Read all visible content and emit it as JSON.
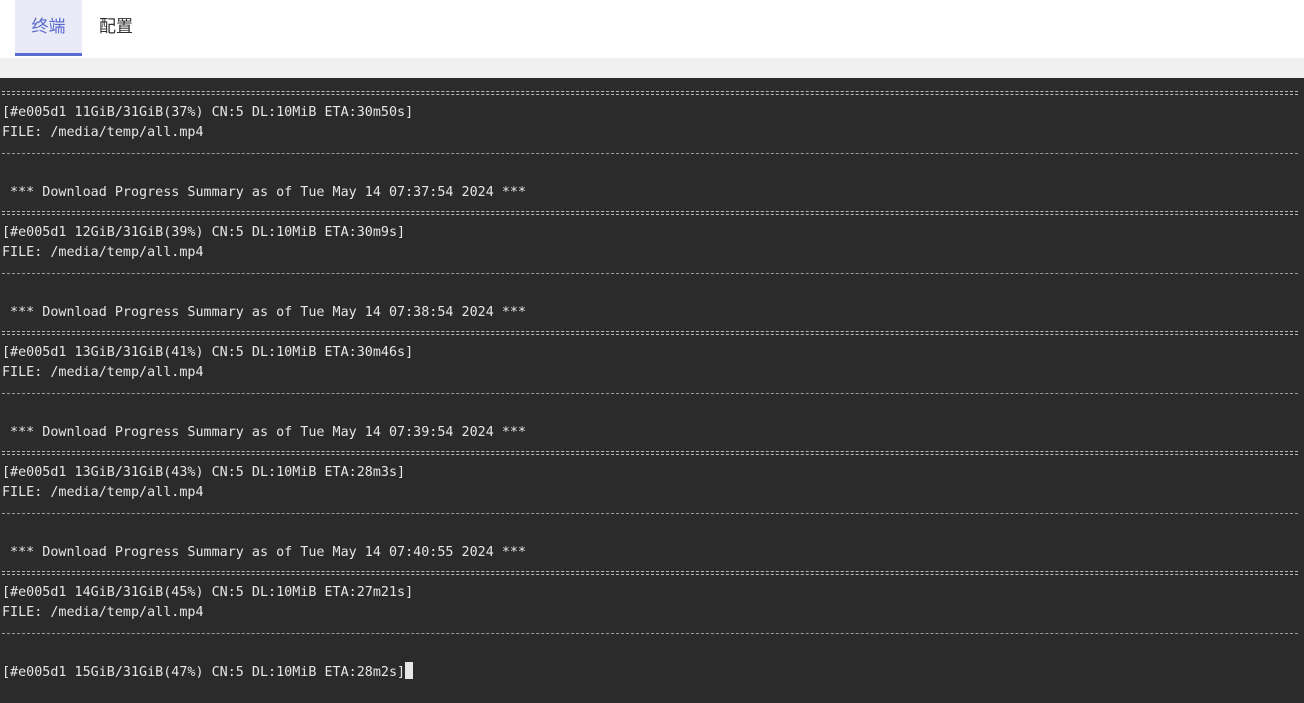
{
  "tabs": [
    {
      "label": "终端",
      "active": true
    },
    {
      "label": "配置",
      "active": false
    }
  ],
  "terminal": {
    "lines": [
      {
        "type": "sep-eq"
      },
      {
        "type": "text",
        "text": "[#e005d1 11GiB/31GiB(37%) CN:5 DL:10MiB ETA:30m50s]"
      },
      {
        "type": "text",
        "text": "FILE: /media/temp/all.mp4"
      },
      {
        "type": "sep-dash"
      },
      {
        "type": "blank"
      },
      {
        "type": "text",
        "text": " *** Download Progress Summary as of Tue May 14 07:37:54 2024 ***"
      },
      {
        "type": "sep-eq"
      },
      {
        "type": "text",
        "text": "[#e005d1 12GiB/31GiB(39%) CN:5 DL:10MiB ETA:30m9s]"
      },
      {
        "type": "text",
        "text": "FILE: /media/temp/all.mp4"
      },
      {
        "type": "sep-dash"
      },
      {
        "type": "blank"
      },
      {
        "type": "text",
        "text": " *** Download Progress Summary as of Tue May 14 07:38:54 2024 ***"
      },
      {
        "type": "sep-eq"
      },
      {
        "type": "text",
        "text": "[#e005d1 13GiB/31GiB(41%) CN:5 DL:10MiB ETA:30m46s]"
      },
      {
        "type": "text",
        "text": "FILE: /media/temp/all.mp4"
      },
      {
        "type": "sep-dash"
      },
      {
        "type": "blank"
      },
      {
        "type": "text",
        "text": " *** Download Progress Summary as of Tue May 14 07:39:54 2024 ***"
      },
      {
        "type": "sep-eq"
      },
      {
        "type": "text",
        "text": "[#e005d1 13GiB/31GiB(43%) CN:5 DL:10MiB ETA:28m3s]"
      },
      {
        "type": "text",
        "text": "FILE: /media/temp/all.mp4"
      },
      {
        "type": "sep-dash"
      },
      {
        "type": "blank"
      },
      {
        "type": "text",
        "text": " *** Download Progress Summary as of Tue May 14 07:40:55 2024 ***"
      },
      {
        "type": "sep-eq"
      },
      {
        "type": "text",
        "text": "[#e005d1 14GiB/31GiB(45%) CN:5 DL:10MiB ETA:27m21s]"
      },
      {
        "type": "text",
        "text": "FILE: /media/temp/all.mp4"
      },
      {
        "type": "sep-dash"
      },
      {
        "type": "blank"
      },
      {
        "type": "prompt",
        "text": "[#e005d1 15GiB/31GiB(47%) CN:5 DL:10MiB ETA:28m2s]"
      }
    ]
  },
  "colors": {
    "terminal_bg": "#2b2b2b",
    "terminal_fg": "#e6e6e6",
    "accent": "#5a6bd1"
  }
}
